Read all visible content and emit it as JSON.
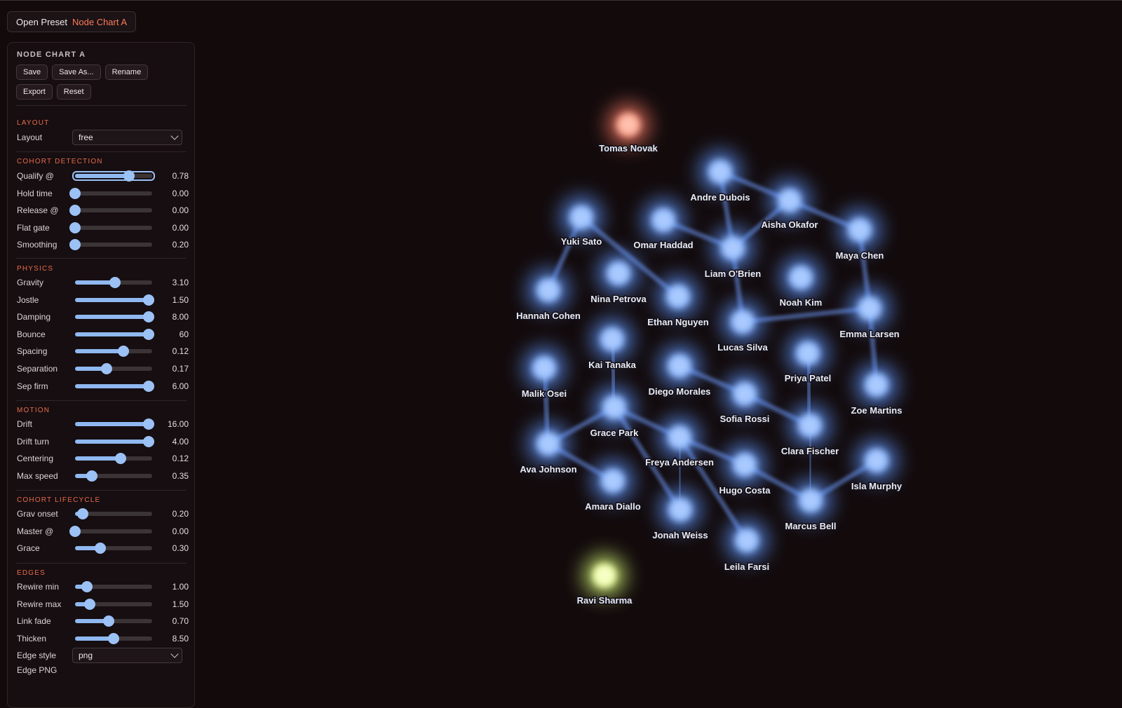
{
  "preset": {
    "label": "Open Preset",
    "name": "Node Chart A"
  },
  "panel": {
    "title": "NODE CHART A",
    "buttons": [
      "Save",
      "Save As...",
      "Rename",
      "Export",
      "Reset"
    ],
    "sections": {
      "layout": "LAYOUT",
      "cohort_detection": "COHORT DETECTION",
      "physics": "PHYSICS",
      "motion": "MOTION",
      "cohort_lifecycle": "COHORT LIFECYCLE",
      "edges": "EDGES"
    },
    "layout_select": {
      "label": "Layout",
      "value": "free"
    },
    "sliders": {
      "cohort_detection": [
        {
          "label": "Qualify @",
          "value": "0.78",
          "level": 0.7
        },
        {
          "label": "Hold time",
          "value": "0.00",
          "level": 0.0
        },
        {
          "label": "Release @",
          "value": "0.00",
          "level": 0.0
        },
        {
          "label": "Flat gate",
          "value": "0.00",
          "level": 0.0
        },
        {
          "label": "Smoothing",
          "value": "0.20",
          "level": 0.0
        }
      ],
      "physics": [
        {
          "label": "Gravity",
          "value": "3.10",
          "level": 0.52
        },
        {
          "label": "Jostle",
          "value": "1.50",
          "level": 0.95
        },
        {
          "label": "Damping",
          "value": "8.00",
          "level": 0.95
        },
        {
          "label": "Bounce",
          "value": "60",
          "level": 0.95
        },
        {
          "label": "Spacing",
          "value": "0.12",
          "level": 0.63
        },
        {
          "label": "Separation",
          "value": "0.17",
          "level": 0.41
        },
        {
          "label": "Sep firm",
          "value": "6.00",
          "level": 0.95
        }
      ],
      "motion": [
        {
          "label": "Drift",
          "value": "16.00",
          "level": 0.95
        },
        {
          "label": "Drift turn",
          "value": "4.00",
          "level": 0.95
        },
        {
          "label": "Centering",
          "value": "0.12",
          "level": 0.59
        },
        {
          "label": "Max speed",
          "value": "0.35",
          "level": 0.22
        }
      ],
      "cohort_lifecycle": [
        {
          "label": "Grav onset",
          "value": "0.20",
          "level": 0.1
        },
        {
          "label": "Master @",
          "value": "0.00",
          "level": 0.0
        },
        {
          "label": "Grace",
          "value": "0.30",
          "level": 0.33
        }
      ],
      "edges": [
        {
          "label": "Rewire min",
          "value": "1.00",
          "level": 0.15
        },
        {
          "label": "Rewire max",
          "value": "1.50",
          "level": 0.19
        },
        {
          "label": "Link fade",
          "value": "0.70",
          "level": 0.44
        },
        {
          "label": "Thicken",
          "value": "8.50",
          "level": 0.5
        }
      ]
    },
    "edge_style": {
      "label": "Edge style",
      "value": "png"
    },
    "edge_png_label": "Edge PNG"
  },
  "graph": {
    "colors": {
      "node": "#5f97ff",
      "node_core": "#9cc2ff",
      "edge": "#6a8fe8",
      "special_red": "#ff7c6a",
      "special_green": "#d8ff7a"
    },
    "nodes": [
      {
        "name": "Tomas Novak",
        "kind": "red"
      },
      {
        "name": "Ravi Sharma",
        "kind": "green"
      },
      {
        "name": "Andre Dubois"
      },
      {
        "name": "Aisha Okafor"
      },
      {
        "name": "Maya Chen"
      },
      {
        "name": "Yuki Sato"
      },
      {
        "name": "Omar Haddad"
      },
      {
        "name": "Liam O'Brien"
      },
      {
        "name": "Noah Kim"
      },
      {
        "name": "Emma Larsen"
      },
      {
        "name": "Hannah Cohen"
      },
      {
        "name": "Nina Petrova"
      },
      {
        "name": "Ethan Nguyen"
      },
      {
        "name": "Lucas Silva"
      },
      {
        "name": "Kai Tanaka"
      },
      {
        "name": "Malik Osei"
      },
      {
        "name": "Diego Morales"
      },
      {
        "name": "Priya Patel"
      },
      {
        "name": "Zoe Martins"
      },
      {
        "name": "Sofia Rossi"
      },
      {
        "name": "Grace Park"
      },
      {
        "name": "Clara Fischer"
      },
      {
        "name": "Ava Johnson"
      },
      {
        "name": "Freya Andersen"
      },
      {
        "name": "Hugo Costa"
      },
      {
        "name": "Isla Murphy"
      },
      {
        "name": "Amara Diallo"
      },
      {
        "name": "Marcus Bell"
      },
      {
        "name": "Jonah Weiss"
      },
      {
        "name": "Leila Farsi"
      }
    ],
    "edges": [
      [
        "Andre Dubois",
        "Aisha Okafor"
      ],
      [
        "Aisha Okafor",
        "Maya Chen"
      ],
      [
        "Aisha Okafor",
        "Liam O'Brien"
      ],
      [
        "Andre Dubois",
        "Liam O'Brien"
      ],
      [
        "Omar Haddad",
        "Liam O'Brien"
      ],
      [
        "Yuki Sato",
        "Ethan Nguyen"
      ],
      [
        "Liam O'Brien",
        "Lucas Silva"
      ],
      [
        "Lucas Silva",
        "Emma Larsen"
      ],
      [
        "Maya Chen",
        "Emma Larsen"
      ],
      [
        "Yuki Sato",
        "Hannah Cohen"
      ],
      [
        "Priya Patel",
        "Clara Fischer"
      ],
      [
        "Clara Fischer",
        "Marcus Bell"
      ],
      [
        "Grace Park",
        "Ava Johnson"
      ],
      [
        "Grace Park",
        "Freya Andersen"
      ],
      [
        "Grace Park",
        "Jonah Weiss"
      ],
      [
        "Freya Andersen",
        "Jonah Weiss"
      ],
      [
        "Freya Andersen",
        "Leila Farsi"
      ],
      [
        "Hugo Costa",
        "Marcus Bell"
      ],
      [
        "Diego Morales",
        "Sofia Rossi"
      ],
      [
        "Sofia Rossi",
        "Clara Fischer"
      ],
      [
        "Malik Osei",
        "Ava Johnson"
      ],
      [
        "Kai Tanaka",
        "Grace Park"
      ],
      [
        "Freya Andersen",
        "Hugo Costa"
      ],
      [
        "Emma Larsen",
        "Zoe Martins"
      ],
      [
        "Ava Johnson",
        "Amara Diallo"
      ],
      [
        "Isla Murphy",
        "Marcus Bell"
      ]
    ]
  }
}
